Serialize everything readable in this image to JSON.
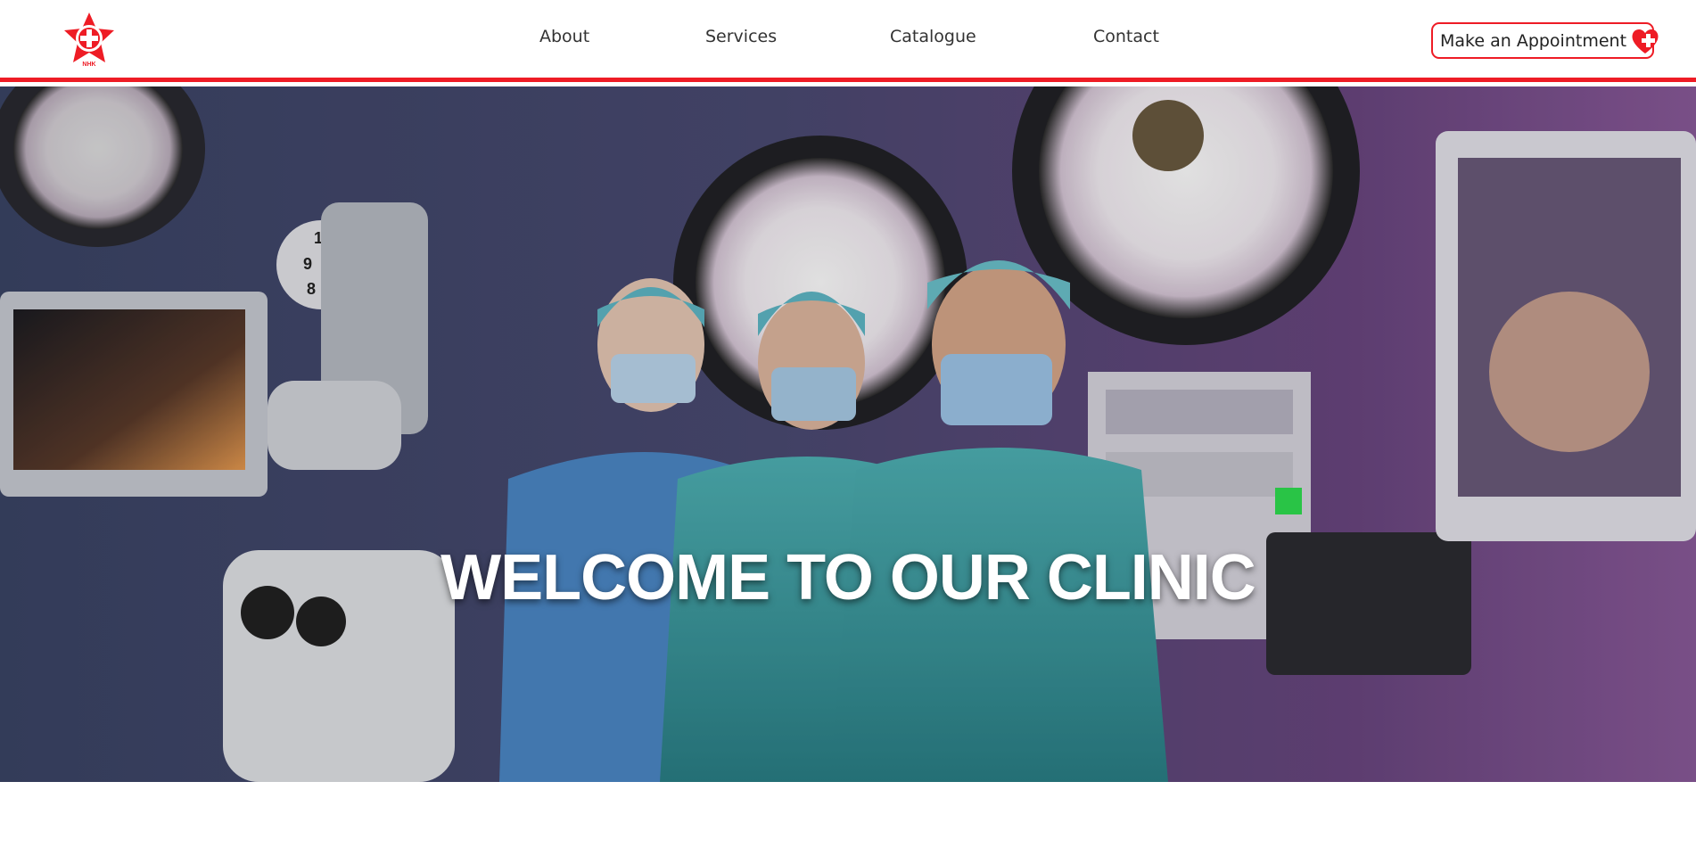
{
  "header": {
    "logo_icon": "star-cross-logo-icon",
    "logo_text": "NHK",
    "accent_color": "#ee1c25"
  },
  "nav": {
    "items": [
      {
        "label": "About"
      },
      {
        "label": "Services"
      },
      {
        "label": "Catalogue"
      },
      {
        "label": "Contact"
      }
    ]
  },
  "cta": {
    "label": "Make an Appointment",
    "icon": "heart-plus-icon"
  },
  "hero": {
    "title": "WELCOME TO OUR CLINIC",
    "background_description_icon": "operating-room-photo"
  }
}
